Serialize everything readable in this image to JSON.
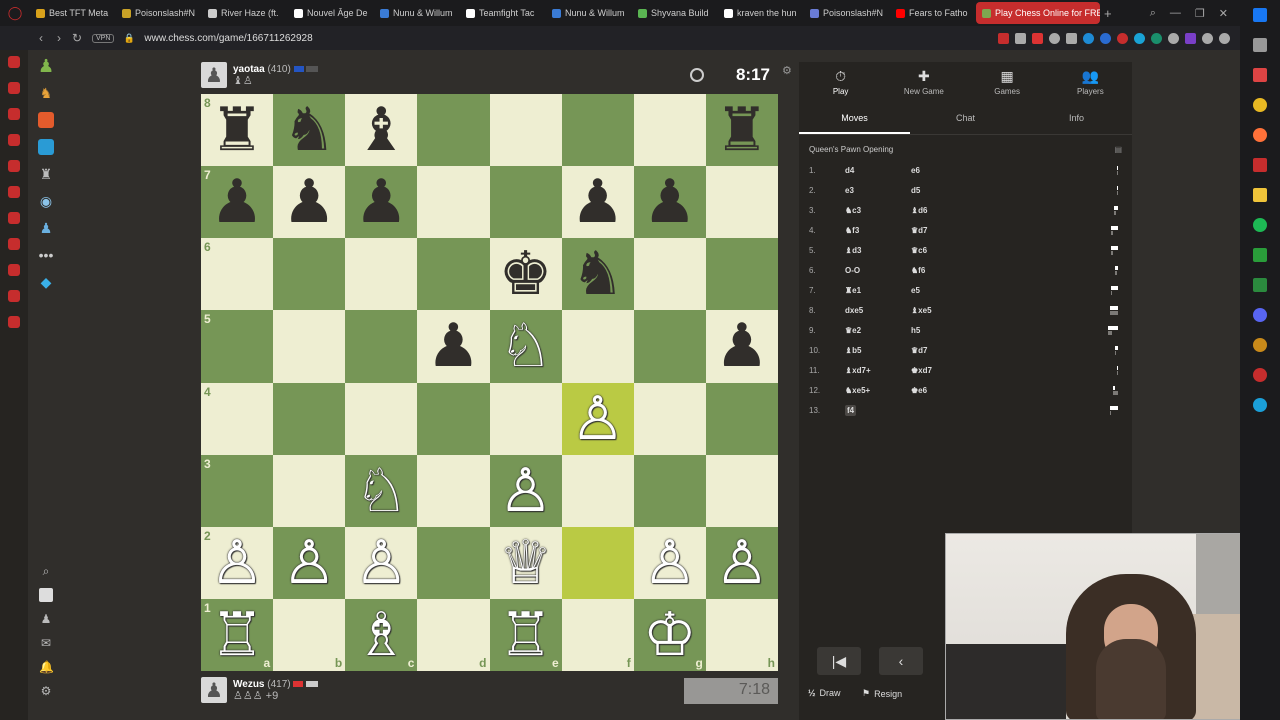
{
  "browser": {
    "tabs": [
      {
        "title": "Best TFT Meta",
        "color": "#d9a21b"
      },
      {
        "title": "Poisonslash#N",
        "color": "#c9a227"
      },
      {
        "title": "River Haze (ft.",
        "color": "#cccccc"
      },
      {
        "title": "Nouvel Âge De",
        "color": "#ffffff"
      },
      {
        "title": "Nunu & Willum",
        "color": "#3a7bd5"
      },
      {
        "title": "Teamfight Tac",
        "color": "#ffffff"
      },
      {
        "title": "Nunu & Willum",
        "color": "#3a7bd5"
      },
      {
        "title": "Shyvana Build",
        "color": "#5ab552"
      },
      {
        "title": "kraven the hun",
        "color": "#ffffff"
      },
      {
        "title": "Poisonslash#N",
        "color": "#6a7cd6"
      },
      {
        "title": "Fears to Fatho",
        "color": "#ff0000"
      },
      {
        "title": "Play Chess Online for FREE",
        "color": "#7fa650",
        "active": true
      }
    ],
    "vpn_label": "VPN",
    "url": "www.chess.com/game/166711262928"
  },
  "top_player": {
    "name": "yaotaa",
    "rating": "(410)",
    "captured": "♝♙",
    "clock": "8:17"
  },
  "bottom_player": {
    "name": "Wezus",
    "rating": "(417)",
    "captured": "♙♙♙ +9",
    "clock": "7:18"
  },
  "board": {
    "ranks": [
      "8",
      "7",
      "6",
      "5",
      "4",
      "3",
      "2",
      "1"
    ],
    "files": [
      "a",
      "b",
      "c",
      "d",
      "e",
      "f",
      "g",
      "h"
    ],
    "position": [
      [
        "♜",
        "♞",
        "♝",
        "",
        "",
        "",
        "",
        "♜"
      ],
      [
        "♟",
        "♟",
        "♟",
        "",
        "",
        "♟",
        "♟",
        ""
      ],
      [
        "",
        "",
        "",
        "",
        "♚",
        "♞",
        "",
        ""
      ],
      [
        "",
        "",
        "",
        "♟",
        "♘",
        "",
        "",
        "♟"
      ],
      [
        "",
        "",
        "",
        "",
        "",
        "♙",
        "",
        ""
      ],
      [
        "",
        "",
        "♘",
        "",
        "♙",
        "",
        "",
        ""
      ],
      [
        "♙",
        "♙",
        "♙",
        "",
        "♕",
        "",
        "♙",
        "♙"
      ],
      [
        "♖",
        "",
        "♗",
        "",
        "♖",
        "",
        "♔",
        ""
      ]
    ],
    "colors": [
      [
        "b",
        "b",
        "b",
        "",
        "",
        "",
        "",
        "b"
      ],
      [
        "b",
        "b",
        "b",
        "",
        "",
        "b",
        "b",
        ""
      ],
      [
        "",
        "",
        "",
        "",
        "b",
        "b",
        "",
        ""
      ],
      [
        "",
        "",
        "",
        "b",
        "w",
        "",
        "",
        "b"
      ],
      [
        "",
        "",
        "",
        "",
        "",
        "w",
        "",
        ""
      ],
      [
        "",
        "",
        "w",
        "",
        "w",
        "",
        "",
        ""
      ],
      [
        "w",
        "w",
        "w",
        "",
        "w",
        "",
        "w",
        "w"
      ],
      [
        "w",
        "",
        "w",
        "",
        "w",
        "",
        "w",
        ""
      ]
    ],
    "highlight": [
      "f4",
      "f2"
    ]
  },
  "panel": {
    "top_tabs": [
      {
        "icon": "⏱",
        "label": "Play"
      },
      {
        "icon": "✚",
        "label": "New Game"
      },
      {
        "icon": "▦",
        "label": "Games"
      },
      {
        "icon": "👥",
        "label": "Players"
      }
    ],
    "sub_tabs": [
      "Moves",
      "Chat",
      "Info"
    ],
    "opening": "Queen's Pawn Opening",
    "moves": [
      {
        "n": "1.",
        "w": "d4",
        "b": "e6",
        "wt": 3.8,
        "bt": 1.2
      },
      {
        "n": "2.",
        "w": "e3",
        "b": "d5",
        "wt": 2.0,
        "bt": 3.8
      },
      {
        "n": "3.",
        "w": "♞c3",
        "b": "♝d6",
        "wt": 10.2,
        "bt": 4.9
      },
      {
        "n": "4.",
        "w": "♞f3",
        "b": "♛d7",
        "wt": 18.7,
        "bt": 6.7
      },
      {
        "n": "5.",
        "w": "♝d3",
        "b": "♛c6",
        "wt": 18.0,
        "bt": 5.7
      },
      {
        "n": "6.",
        "w": "O-O",
        "b": "♞f6",
        "wt": 6.9,
        "bt": 5.1
      },
      {
        "n": "7.",
        "w": "♜e1",
        "b": "e5",
        "wt": 17.7,
        "bt": 2.9
      },
      {
        "n": "8.",
        "w": "dxe5",
        "b": "♝xe5",
        "wt": 21.1,
        "bt": 21.6
      },
      {
        "n": "9.",
        "w": "♛e2",
        "b": "h5",
        "wt": 27.0,
        "bt": 10.9
      },
      {
        "n": "10.",
        "w": "♝b5",
        "b": "♛d7",
        "wt": 8.9,
        "bt": 3.5
      },
      {
        "n": "11.",
        "w": "♝xd7+",
        "b": "♚xd7",
        "wt": 1.5,
        "bt": 0.1
      },
      {
        "n": "12.",
        "w": "♞xe5+",
        "b": "♚e6",
        "wt": 5.1,
        "bt": 13.7
      },
      {
        "n": "13.",
        "w": "f4",
        "b": "",
        "wt": 21.1,
        "bt": 0
      }
    ],
    "draw_label": "Draw",
    "resign_label": "Resign",
    "half_icon": "½"
  }
}
